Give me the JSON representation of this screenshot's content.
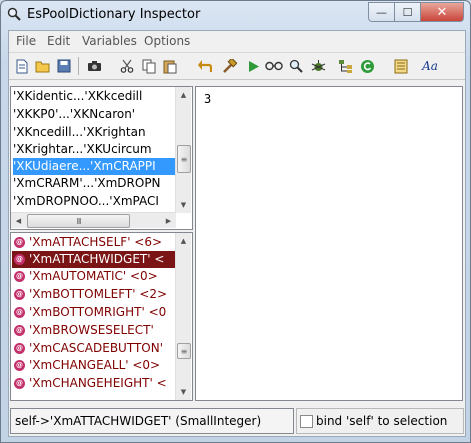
{
  "window": {
    "title": "EsPoolDictionary Inspector",
    "minimize": "—",
    "maximize": "☐",
    "close": "✕"
  },
  "menu": [
    "File",
    "Edit",
    "Variables",
    "Options"
  ],
  "toolbar_icons": [
    "new-icon",
    "open-icon",
    "save-icon",
    "camera-icon",
    "cut-icon",
    "copy-icon",
    "paste-icon",
    "undo-icon",
    "hammer-icon",
    "run-icon",
    "inspect-icon",
    "search-icon",
    "debug-icon",
    "hierarchy-icon",
    "refresh-icon",
    "browser-icon",
    "font-icon"
  ],
  "top_list": {
    "items": [
      "'XKidentic...'XKkcedill",
      "'XKKP0'...'XKNcaron'",
      "'XKncedill...'XKrightan",
      "'XKrightar...'XKUcircum",
      "'XKUdiaere...'XmCRAPPI",
      "'XmCRARM'...'XmDROPN",
      "'XmDROPNOO...'XmPACI"
    ],
    "selected_index": 4
  },
  "bottom_list": {
    "items": [
      "'XmATTACHSELF' <6>",
      "'XmATTACHWIDGET' <",
      "'XmAUTOMATIC' <0>",
      "'XmBOTTOMLEFT' <2>",
      "'XmBOTTOMRIGHT' <0",
      "'XmBROWSESELECT' ",
      "'XmCASCADEBUTTON' ",
      "'XmCHANGEALL' <0>",
      "'XmCHANGEHEIGHT' <"
    ],
    "selected_index": 1
  },
  "text_view": {
    "value": "3"
  },
  "status": {
    "text": "self->'XmATTACHWIDGET' (SmallInteger)",
    "checkbox_label": "bind 'self' to selection"
  },
  "colors": {
    "selection_blue": "#3399ff",
    "selection_maroon": "#7b1414",
    "item_text_maroon": "#800000"
  }
}
